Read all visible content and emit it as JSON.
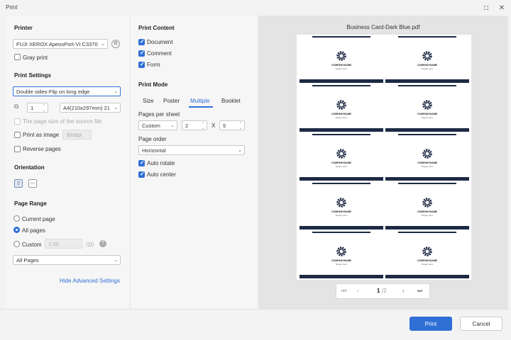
{
  "window": {
    "title": "Print"
  },
  "left": {
    "printer_heading": "Printer",
    "printer_name": "FUJI XEROX ApeosPort-VI C3370",
    "gray_print": "Gray print",
    "settings_heading": "Print Settings",
    "duplex": "Double sides-Flip on long edge",
    "copies": "1",
    "paper": "A4(210x297mm) 21",
    "page_size_source": "The page size of the source file",
    "print_as_image": "Print as image",
    "dpi": "300dpi",
    "reverse_pages": "Reverse pages",
    "orientation_heading": "Orientation",
    "page_range_heading": "Page Range",
    "current_page": "Current page",
    "all_pages": "All pages",
    "custom": "Custom",
    "custom_range": "1-20",
    "custom_total": "/20",
    "subset": "All Pages",
    "hide_advanced": "Hide Advanced Settings"
  },
  "mid": {
    "content_heading": "Print Content",
    "document": "Document",
    "comment": "Comment",
    "form": "Form",
    "mode_heading": "Print Mode",
    "tabs": [
      "Size",
      "Poster",
      "Multiple",
      "Booklet"
    ],
    "pages_per_sheet": "Pages per sheet",
    "pps_select": "Custom",
    "cols": "2",
    "times": "X",
    "rows": "5",
    "page_order_label": "Page order",
    "page_order": "Horizontal",
    "auto_rotate": "Auto rotate",
    "auto_center": "Auto center"
  },
  "preview": {
    "file_name": "Business Card-Dark Blue.pdf",
    "card_name": "COMPANYNAME",
    "card_slogan": "Slogan Here",
    "page_current": "1",
    "page_total": "/2"
  },
  "footer": {
    "print": "Print",
    "cancel": "Cancel"
  },
  "colors": {
    "accent": "#2f6fd6",
    "card_dark": "#1d2a44"
  }
}
